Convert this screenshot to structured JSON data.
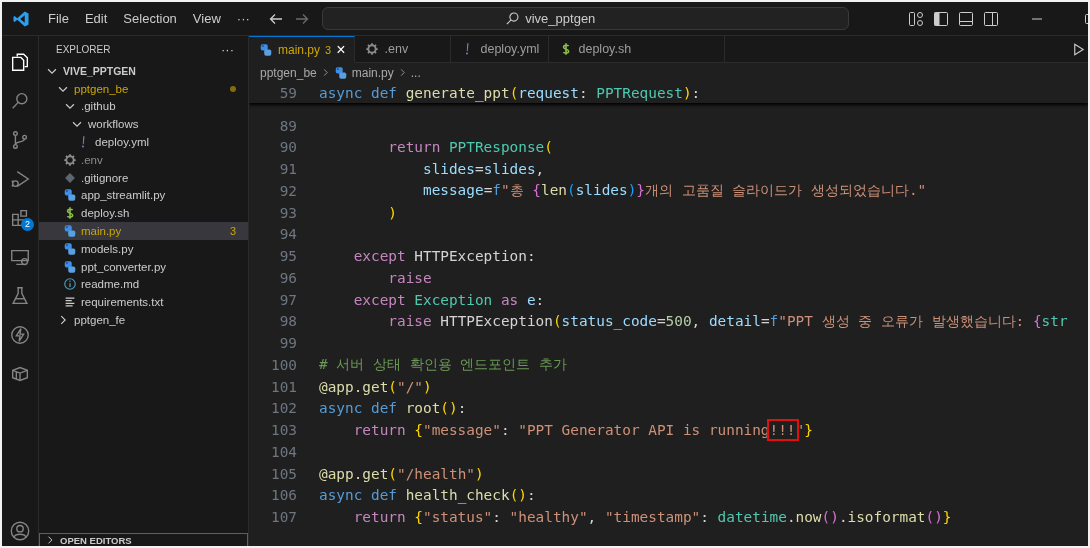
{
  "title_bar": {
    "menus": [
      "File",
      "Edit",
      "Selection",
      "View"
    ],
    "more": "···",
    "search": {
      "value": "vive_pptgen"
    }
  },
  "activity_bar": {
    "items": [
      {
        "kind": "files",
        "selected": true
      },
      {
        "kind": "search",
        "selected": false
      },
      {
        "kind": "source-control",
        "selected": false
      },
      {
        "kind": "run-debug",
        "selected": false
      },
      {
        "kind": "extensions",
        "selected": false,
        "badge": "2"
      },
      {
        "kind": "remote",
        "selected": false
      },
      {
        "kind": "testing",
        "selected": false
      },
      {
        "kind": "lightning",
        "selected": false
      },
      {
        "kind": "box",
        "selected": false
      }
    ]
  },
  "explorer": {
    "title": "EXPLORER",
    "more": "···",
    "tree": [
      {
        "name": "VIVE_PPTGEN",
        "kind": "root",
        "expanded": true,
        "selected": false,
        "children": [
          {
            "name": "pptgen_be",
            "kind": "folder",
            "expanded": true,
            "selected": false,
            "warning": true,
            "children": [
              {
                "name": ".github",
                "kind": "folder",
                "expanded": true,
                "selected": false,
                "warning": false,
                "children": [
                  {
                    "name": "workflows",
                    "kind": "folder",
                    "expanded": true,
                    "selected": false,
                    "warning": false,
                    "children": [
                      {
                        "name": "deploy.yml",
                        "kind": "yaml",
                        "selected": false
                      }
                    ]
                  }
                ]
              },
              {
                "name": ".env",
                "kind": "env",
                "selected": false,
                "dimmed": true
              },
              {
                "name": ".gitignore",
                "kind": "git",
                "selected": false
              },
              {
                "name": "app_streamlit.py",
                "kind": "python",
                "selected": false
              },
              {
                "name": "deploy.sh",
                "kind": "shell",
                "selected": false
              },
              {
                "name": "main.py",
                "kind": "python",
                "selected": true,
                "problems": "3"
              },
              {
                "name": "models.py",
                "kind": "python",
                "selected": false
              },
              {
                "name": "ppt_converter.py",
                "kind": "python",
                "selected": false
              },
              {
                "name": "readme.md",
                "kind": "info",
                "selected": false
              },
              {
                "name": "requirements.txt",
                "kind": "text",
                "selected": false
              }
            ]
          },
          {
            "name": "pptgen_fe",
            "kind": "folder",
            "expanded": false,
            "selected": false,
            "warning": false
          }
        ]
      }
    ],
    "open_editors": {
      "label": "OPEN EDITORS",
      "expanded": false
    }
  },
  "tabs": [
    {
      "name": "main.py",
      "kind": "python",
      "selected": true,
      "problems": "3",
      "close": "×"
    },
    {
      "name": ".env",
      "kind": "env",
      "selected": false
    },
    {
      "name": "deploy.yml",
      "kind": "yaml",
      "selected": false
    },
    {
      "name": "deploy.sh",
      "kind": "shell",
      "selected": false
    }
  ],
  "breadcrumb": [
    {
      "text": "pptgen_be",
      "kind": "folder"
    },
    {
      "text": "main.py",
      "kind": "python"
    },
    {
      "text": "...",
      "kind": "more"
    }
  ],
  "editor": {
    "sticky": {
      "number": "59",
      "tokens": [
        {
          "kind": "kw",
          "text": "async"
        },
        {
          "kind": "kw",
          "text": " def"
        },
        {
          "kind": "fn",
          "text": " generate_ppt"
        },
        {
          "kind": "p1",
          "text": "("
        },
        {
          "kind": "var",
          "text": "request"
        },
        {
          "kind": "plain",
          "text": ": "
        },
        {
          "kind": "type",
          "text": "PPTRequest"
        },
        {
          "kind": "p1",
          "text": ")"
        },
        {
          "kind": "plain",
          "text": ":"
        }
      ]
    },
    "lines": [
      {
        "number": "89"
      },
      {
        "number": "90",
        "tokens": [
          {
            "kind": "ctrl",
            "text": "        return"
          },
          {
            "kind": "type",
            "text": " PPTResponse"
          },
          {
            "kind": "p1",
            "text": "("
          }
        ]
      },
      {
        "number": "91",
        "tokens": [
          {
            "kind": "var",
            "text": "            slides"
          },
          {
            "kind": "plain",
            "text": "="
          },
          {
            "kind": "var",
            "text": "slides"
          },
          {
            "kind": "plain",
            "text": ","
          }
        ]
      },
      {
        "number": "92",
        "tokens": [
          {
            "kind": "var",
            "text": "            message"
          },
          {
            "kind": "plain",
            "text": "="
          },
          {
            "kind": "kw",
            "text": "f"
          },
          {
            "kind": "str",
            "text": "\"총 "
          },
          {
            "kind": "p2",
            "text": "{"
          },
          {
            "kind": "fn",
            "text": "len"
          },
          {
            "kind": "p3",
            "text": "("
          },
          {
            "kind": "var",
            "text": "slides"
          },
          {
            "kind": "p3",
            "text": ")"
          },
          {
            "kind": "p2",
            "text": "}"
          },
          {
            "kind": "str",
            "text": "개의 고품질 슬라이드가 생성되었습니다.\""
          }
        ]
      },
      {
        "number": "93",
        "tokens": [
          {
            "kind": "p1",
            "text": "        )"
          }
        ]
      },
      {
        "number": "94"
      },
      {
        "number": "95",
        "tokens": [
          {
            "kind": "ctrl",
            "text": "    except"
          },
          {
            "kind": "plain",
            "text": " HTTPException:"
          }
        ]
      },
      {
        "number": "96",
        "tokens": [
          {
            "kind": "ctrl",
            "text": "        raise"
          }
        ]
      },
      {
        "number": "97",
        "tokens": [
          {
            "kind": "ctrl",
            "text": "    except"
          },
          {
            "kind": "type",
            "text": " Exception"
          },
          {
            "kind": "ctrl",
            "text": " as"
          },
          {
            "kind": "var",
            "text": " e"
          },
          {
            "kind": "plain",
            "text": ":"
          }
        ]
      },
      {
        "number": "98",
        "tokens": [
          {
            "kind": "ctrl",
            "text": "        raise"
          },
          {
            "kind": "plain",
            "text": " HTTPException"
          },
          {
            "kind": "p1",
            "text": "("
          },
          {
            "kind": "var",
            "text": "status_code"
          },
          {
            "kind": "plain",
            "text": "="
          },
          {
            "kind": "num",
            "text": "500"
          },
          {
            "kind": "plain",
            "text": ", "
          },
          {
            "kind": "var",
            "text": "detail"
          },
          {
            "kind": "plain",
            "text": "="
          },
          {
            "kind": "kw",
            "text": "f"
          },
          {
            "kind": "str",
            "text": "\"PPT 생성 중 오류가 발생했습니다: "
          },
          {
            "kind": "p2",
            "text": "{"
          },
          {
            "kind": "type",
            "text": "str"
          }
        ]
      },
      {
        "number": "99"
      },
      {
        "number": "100",
        "tokens": [
          {
            "kind": "comment",
            "text": "# 서버 상태 확인용 엔드포인트 추가"
          }
        ]
      },
      {
        "number": "101",
        "tokens": [
          {
            "kind": "fn",
            "text": "@app.get"
          },
          {
            "kind": "p1",
            "text": "("
          },
          {
            "kind": "str",
            "text": "\"/\""
          },
          {
            "kind": "p1",
            "text": ")"
          }
        ]
      },
      {
        "number": "102",
        "tokens": [
          {
            "kind": "kw",
            "text": "async"
          },
          {
            "kind": "kw",
            "text": " def"
          },
          {
            "kind": "fn",
            "text": " root"
          },
          {
            "kind": "p1",
            "text": "()"
          },
          {
            "kind": "plain",
            "text": ":"
          }
        ]
      },
      {
        "number": "103",
        "tokens": [
          {
            "kind": "ctrl",
            "text": "    return"
          },
          {
            "kind": "p1",
            "text": " {"
          },
          {
            "kind": "str",
            "text": "\"message\""
          },
          {
            "kind": "plain",
            "text": ": "
          },
          {
            "kind": "str",
            "text": "\"PPT Generator API is running"
          },
          {
            "kind": "marked",
            "text": "!!!"
          },
          {
            "kind": "str",
            "text": "\""
          },
          {
            "kind": "p1",
            "text": "}"
          }
        ]
      },
      {
        "number": "104"
      },
      {
        "number": "105",
        "tokens": [
          {
            "kind": "fn",
            "text": "@app.get"
          },
          {
            "kind": "p1",
            "text": "("
          },
          {
            "kind": "str",
            "text": "\"/health\""
          },
          {
            "kind": "p1",
            "text": ")"
          }
        ]
      },
      {
        "number": "106",
        "tokens": [
          {
            "kind": "kw",
            "text": "async"
          },
          {
            "kind": "kw",
            "text": " def"
          },
          {
            "kind": "fn",
            "text": " health_check"
          },
          {
            "kind": "p1",
            "text": "()"
          },
          {
            "kind": "plain",
            "text": ":"
          }
        ]
      },
      {
        "number": "107",
        "tokens": [
          {
            "kind": "ctrl",
            "text": "    return"
          },
          {
            "kind": "p1",
            "text": " {"
          },
          {
            "kind": "str",
            "text": "\"status\""
          },
          {
            "kind": "plain",
            "text": ": "
          },
          {
            "kind": "str",
            "text": "\"healthy\""
          },
          {
            "kind": "plain",
            "text": ", "
          },
          {
            "kind": "str",
            "text": "\"timestamp\""
          },
          {
            "kind": "plain",
            "text": ": "
          },
          {
            "kind": "type",
            "text": "datetime"
          },
          {
            "kind": "plain",
            "text": "."
          },
          {
            "kind": "fn",
            "text": "now"
          },
          {
            "kind": "p2",
            "text": "()"
          },
          {
            "kind": "plain",
            "text": "."
          },
          {
            "kind": "fn",
            "text": "isoformat"
          },
          {
            "kind": "p2",
            "text": "()"
          },
          {
            "kind": "p1",
            "text": "}"
          }
        ]
      }
    ]
  }
}
